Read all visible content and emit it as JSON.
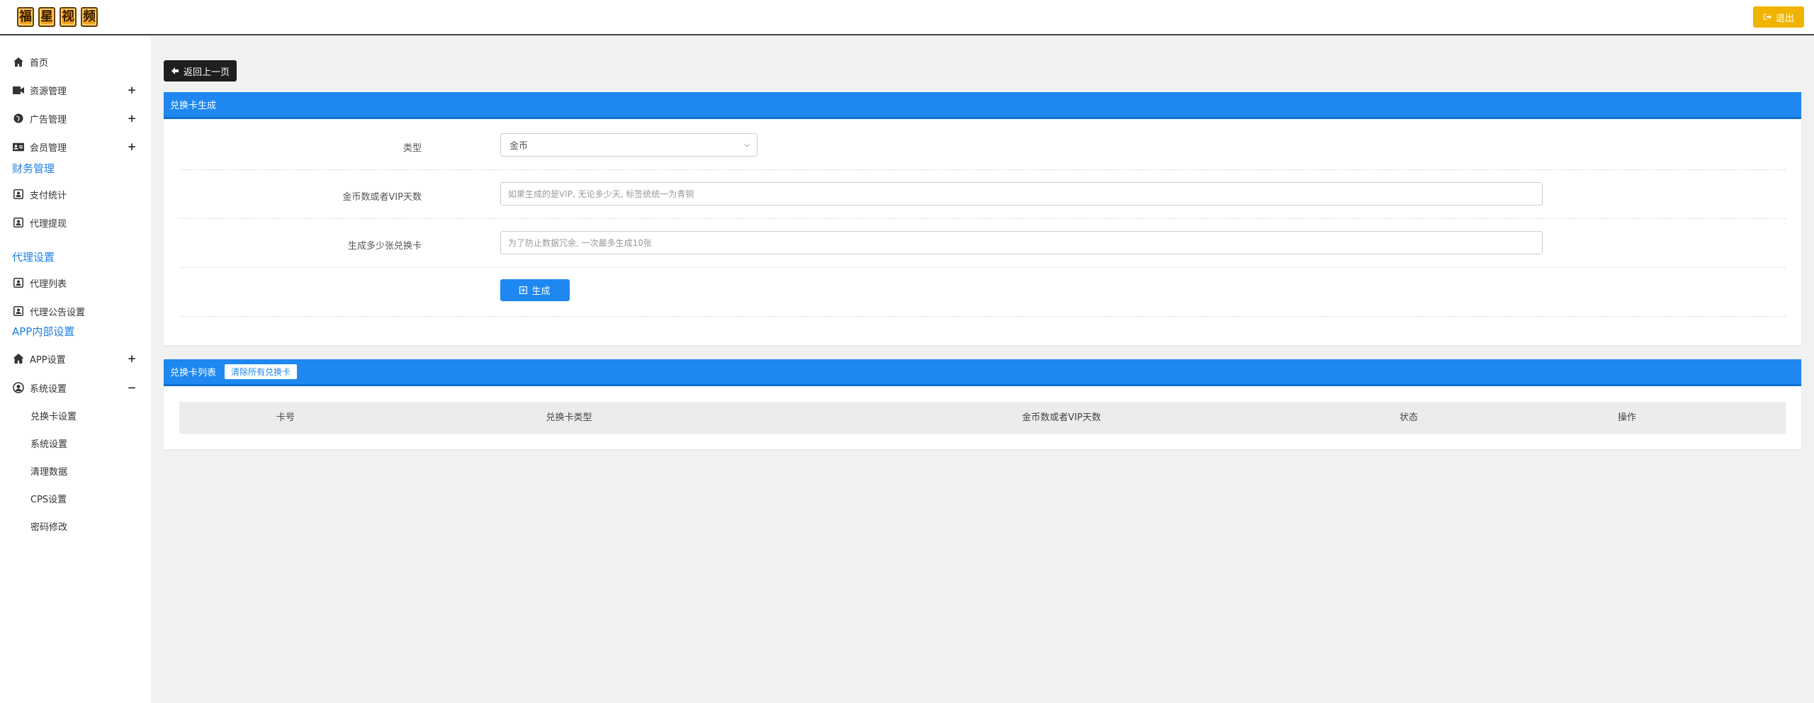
{
  "header": {
    "logo_chars": [
      "福",
      "星",
      "视",
      "频"
    ],
    "logout_label": "退出"
  },
  "sidebar": {
    "items": [
      {
        "label": "首页",
        "icon": "home-icon",
        "toggle": ""
      },
      {
        "label": "资源管理",
        "icon": "video-camera-icon",
        "toggle": "+"
      },
      {
        "label": "广告管理",
        "icon": "globe-icon",
        "toggle": "+"
      },
      {
        "label": "会员管理",
        "icon": "id-card-icon",
        "toggle": "+"
      }
    ],
    "finance_section": "财务管理",
    "finance_items": [
      {
        "label": "支付统计",
        "icon": "person-badge-icon"
      },
      {
        "label": "代理提现",
        "icon": "person-badge-icon"
      }
    ],
    "agent_section": "代理设置",
    "agent_items": [
      {
        "label": "代理列表",
        "icon": "person-badge-icon"
      },
      {
        "label": "代理公告设置",
        "icon": "person-badge-icon"
      }
    ],
    "app_section": "APP内部设置",
    "app_items": [
      {
        "label": "APP设置",
        "icon": "home-icon",
        "toggle": "+"
      },
      {
        "label": "系统设置",
        "icon": "user-circle-icon",
        "toggle": "−"
      }
    ],
    "sub_items": [
      "兑换卡设置",
      "系统设置",
      "清理数据",
      "CPS设置",
      "密码修改"
    ]
  },
  "main": {
    "back_label": "返回上一页",
    "gen_panel": {
      "title": "兑换卡生成",
      "type_label": "类型",
      "type_value": "金币",
      "amount_label": "金币数或者VIP天数",
      "amount_placeholder": "如果生成的是VIP, 无论多少天, 标签统统一为青铜",
      "count_label": "生成多少张兑换卡",
      "count_placeholder": "为了防止数据冗余, 一次最多生成10张",
      "submit_label": "生成"
    },
    "list_panel": {
      "title": "兑换卡列表",
      "clear_label": "清除所有兑换卡",
      "columns": [
        "卡号",
        "兑换卡类型",
        "金币数或者VIP天数",
        "状态",
        "操作"
      ]
    }
  },
  "colors": {
    "primary": "#1e88f0",
    "warning": "#f0b400",
    "section_text": "#1e7fe6"
  }
}
